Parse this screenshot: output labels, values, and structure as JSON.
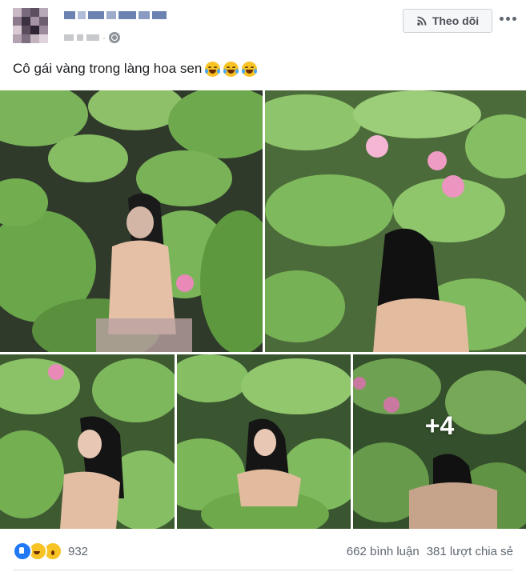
{
  "post": {
    "author_name": "",
    "follow_label": "Theo dõi",
    "more_label": "•••",
    "caption_text": "Cô gái vàng trong làng hoa sen",
    "caption_emojis": [
      "face-with-tears-of-joy",
      "face-with-tears-of-joy",
      "face-with-tears-of-joy"
    ]
  },
  "photos": {
    "count_overlay": "+4",
    "items": [
      {
        "subject": "lotus-pond-photo-1"
      },
      {
        "subject": "lotus-pond-photo-2"
      },
      {
        "subject": "lotus-pond-photo-3"
      },
      {
        "subject": "lotus-pond-photo-4"
      },
      {
        "subject": "lotus-pond-photo-5"
      }
    ]
  },
  "footer": {
    "reactions": [
      "like",
      "haha",
      "wow"
    ],
    "reaction_count": "932",
    "comments": "662 bình luận",
    "shares": "381 lượt chia sẻ"
  },
  "colors": {
    "leaf": "#6fa94e",
    "leaf_dark": "#3f6b2e",
    "water": "#2f3a2a",
    "lotus_pink": "#e889b8",
    "accent": "#2078f4"
  }
}
